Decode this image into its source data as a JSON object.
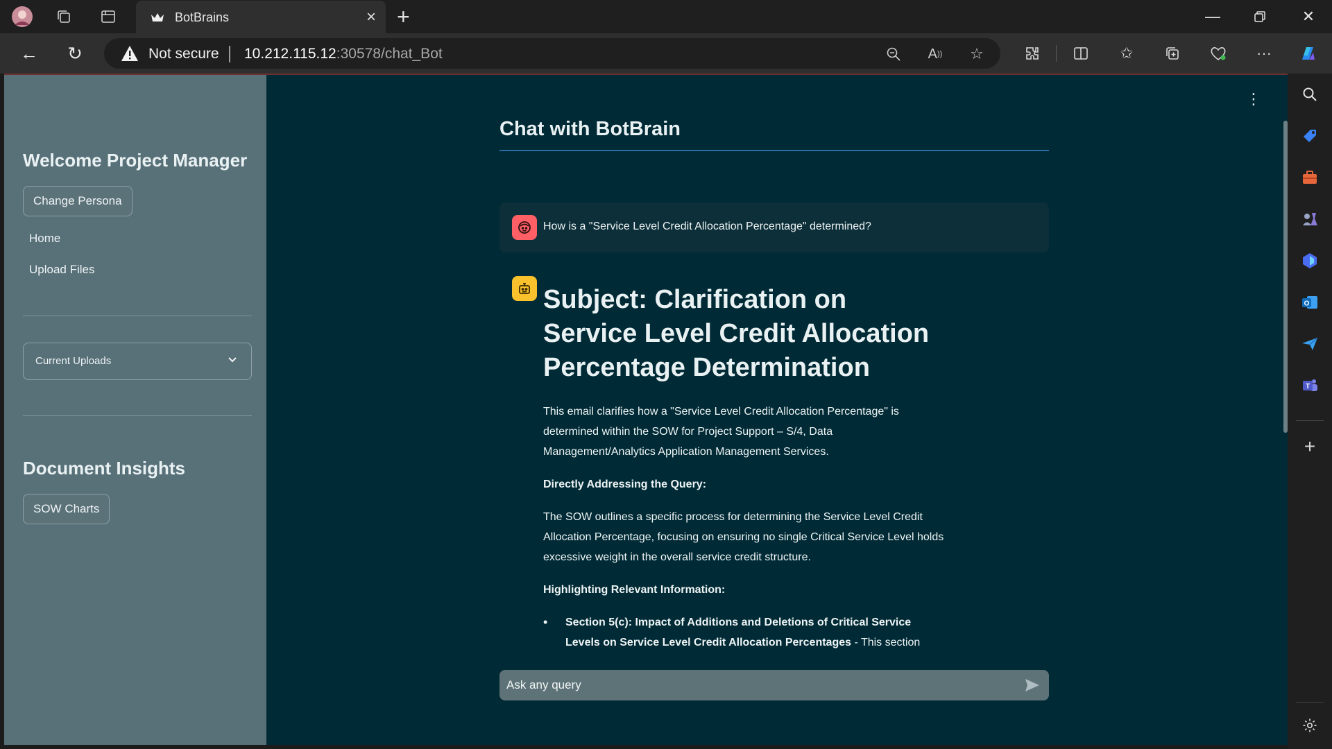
{
  "browser": {
    "tab_title": "BotBrains",
    "security_label": "Not secure",
    "url_host": "10.212.115.12",
    "url_path": ":30578/chat_Bot"
  },
  "sidebar": {
    "welcome_heading": "Welcome Project Manager",
    "change_persona_label": "Change Persona",
    "nav": [
      {
        "label": "Home"
      },
      {
        "label": "Upload Files"
      }
    ],
    "uploads_label": "Current Uploads",
    "insights_heading": "Document Insights",
    "sow_charts_label": "SOW Charts"
  },
  "chat": {
    "title": "Chat with BotBrain",
    "user_message": "How is a \"Service Level Credit Allocation Percentage\" determined?",
    "bot": {
      "heading": "Subject: Clarification on Service Level Credit Allocation Percentage Determination",
      "intro": "This email clarifies how a \"Service Level Credit Allocation Percentage\" is determined within the SOW for Project Support – S/4, Data Management/Analytics Application Management Services.",
      "query_heading": "Directly Addressing the Query:",
      "query_text": "The SOW outlines a specific process for determining the Service Level Credit Allocation Percentage, focusing on ensuring no single Critical Service Level holds excessive weight in the overall service credit structure.",
      "highlight_heading": "Highlighting Relevant Information:",
      "bullet_bold": "Section 5(c): Impact of Additions and Deletions of Critical Service Levels on Service Level Credit Allocation Percentages",
      "bullet_text": " - This section"
    },
    "input_placeholder": "Ask any query"
  },
  "colors": {
    "app_background": "#002a35",
    "sidebar_background": "#587078",
    "user_avatar": "#ff5f65",
    "bot_avatar": "#f9c12b",
    "title_underline": "#2c6da4"
  }
}
